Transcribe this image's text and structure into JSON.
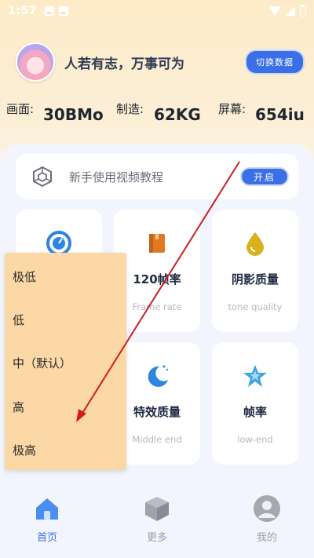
{
  "status_bar": {
    "time": "1:57"
  },
  "header": {
    "motto": "人若有志，万事可为",
    "switch_label": "切换数据"
  },
  "stats": [
    {
      "label": "画面:",
      "value": "30BMo"
    },
    {
      "label": "制造:",
      "value": "62KG"
    },
    {
      "label": "屏幕:",
      "value": "654iu"
    }
  ],
  "tutorial": {
    "text": "新手使用视频教程",
    "button_label": "开启"
  },
  "cards": [
    {
      "title": "",
      "subtitle": "",
      "icon": "gauge-icon"
    },
    {
      "title": "120帧率",
      "subtitle": "Frame rate",
      "icon": "book-icon"
    },
    {
      "title": "阴影质量",
      "subtitle": "tone quality",
      "icon": "drop-icon"
    },
    {
      "title": "",
      "subtitle": "",
      "icon": "unknown"
    },
    {
      "title": "特效质量",
      "subtitle": "Middle end",
      "icon": "moon-icon"
    },
    {
      "title": "帧率",
      "subtitle": "low-end",
      "icon": "star-icon"
    }
  ],
  "dropdown": {
    "options": [
      "极低",
      "低",
      "中（默认）",
      "高",
      "极高"
    ]
  },
  "bottom_nav": [
    {
      "label": "首页",
      "icon": "home-icon",
      "active": true
    },
    {
      "label": "更多",
      "icon": "cube-icon",
      "active": false
    },
    {
      "label": "我的",
      "icon": "user-icon",
      "active": false
    }
  ],
  "colors": {
    "accent": "#3b6fe6",
    "dropdown_bg": "#fcd8a6",
    "arrow": "#d01e1e"
  }
}
